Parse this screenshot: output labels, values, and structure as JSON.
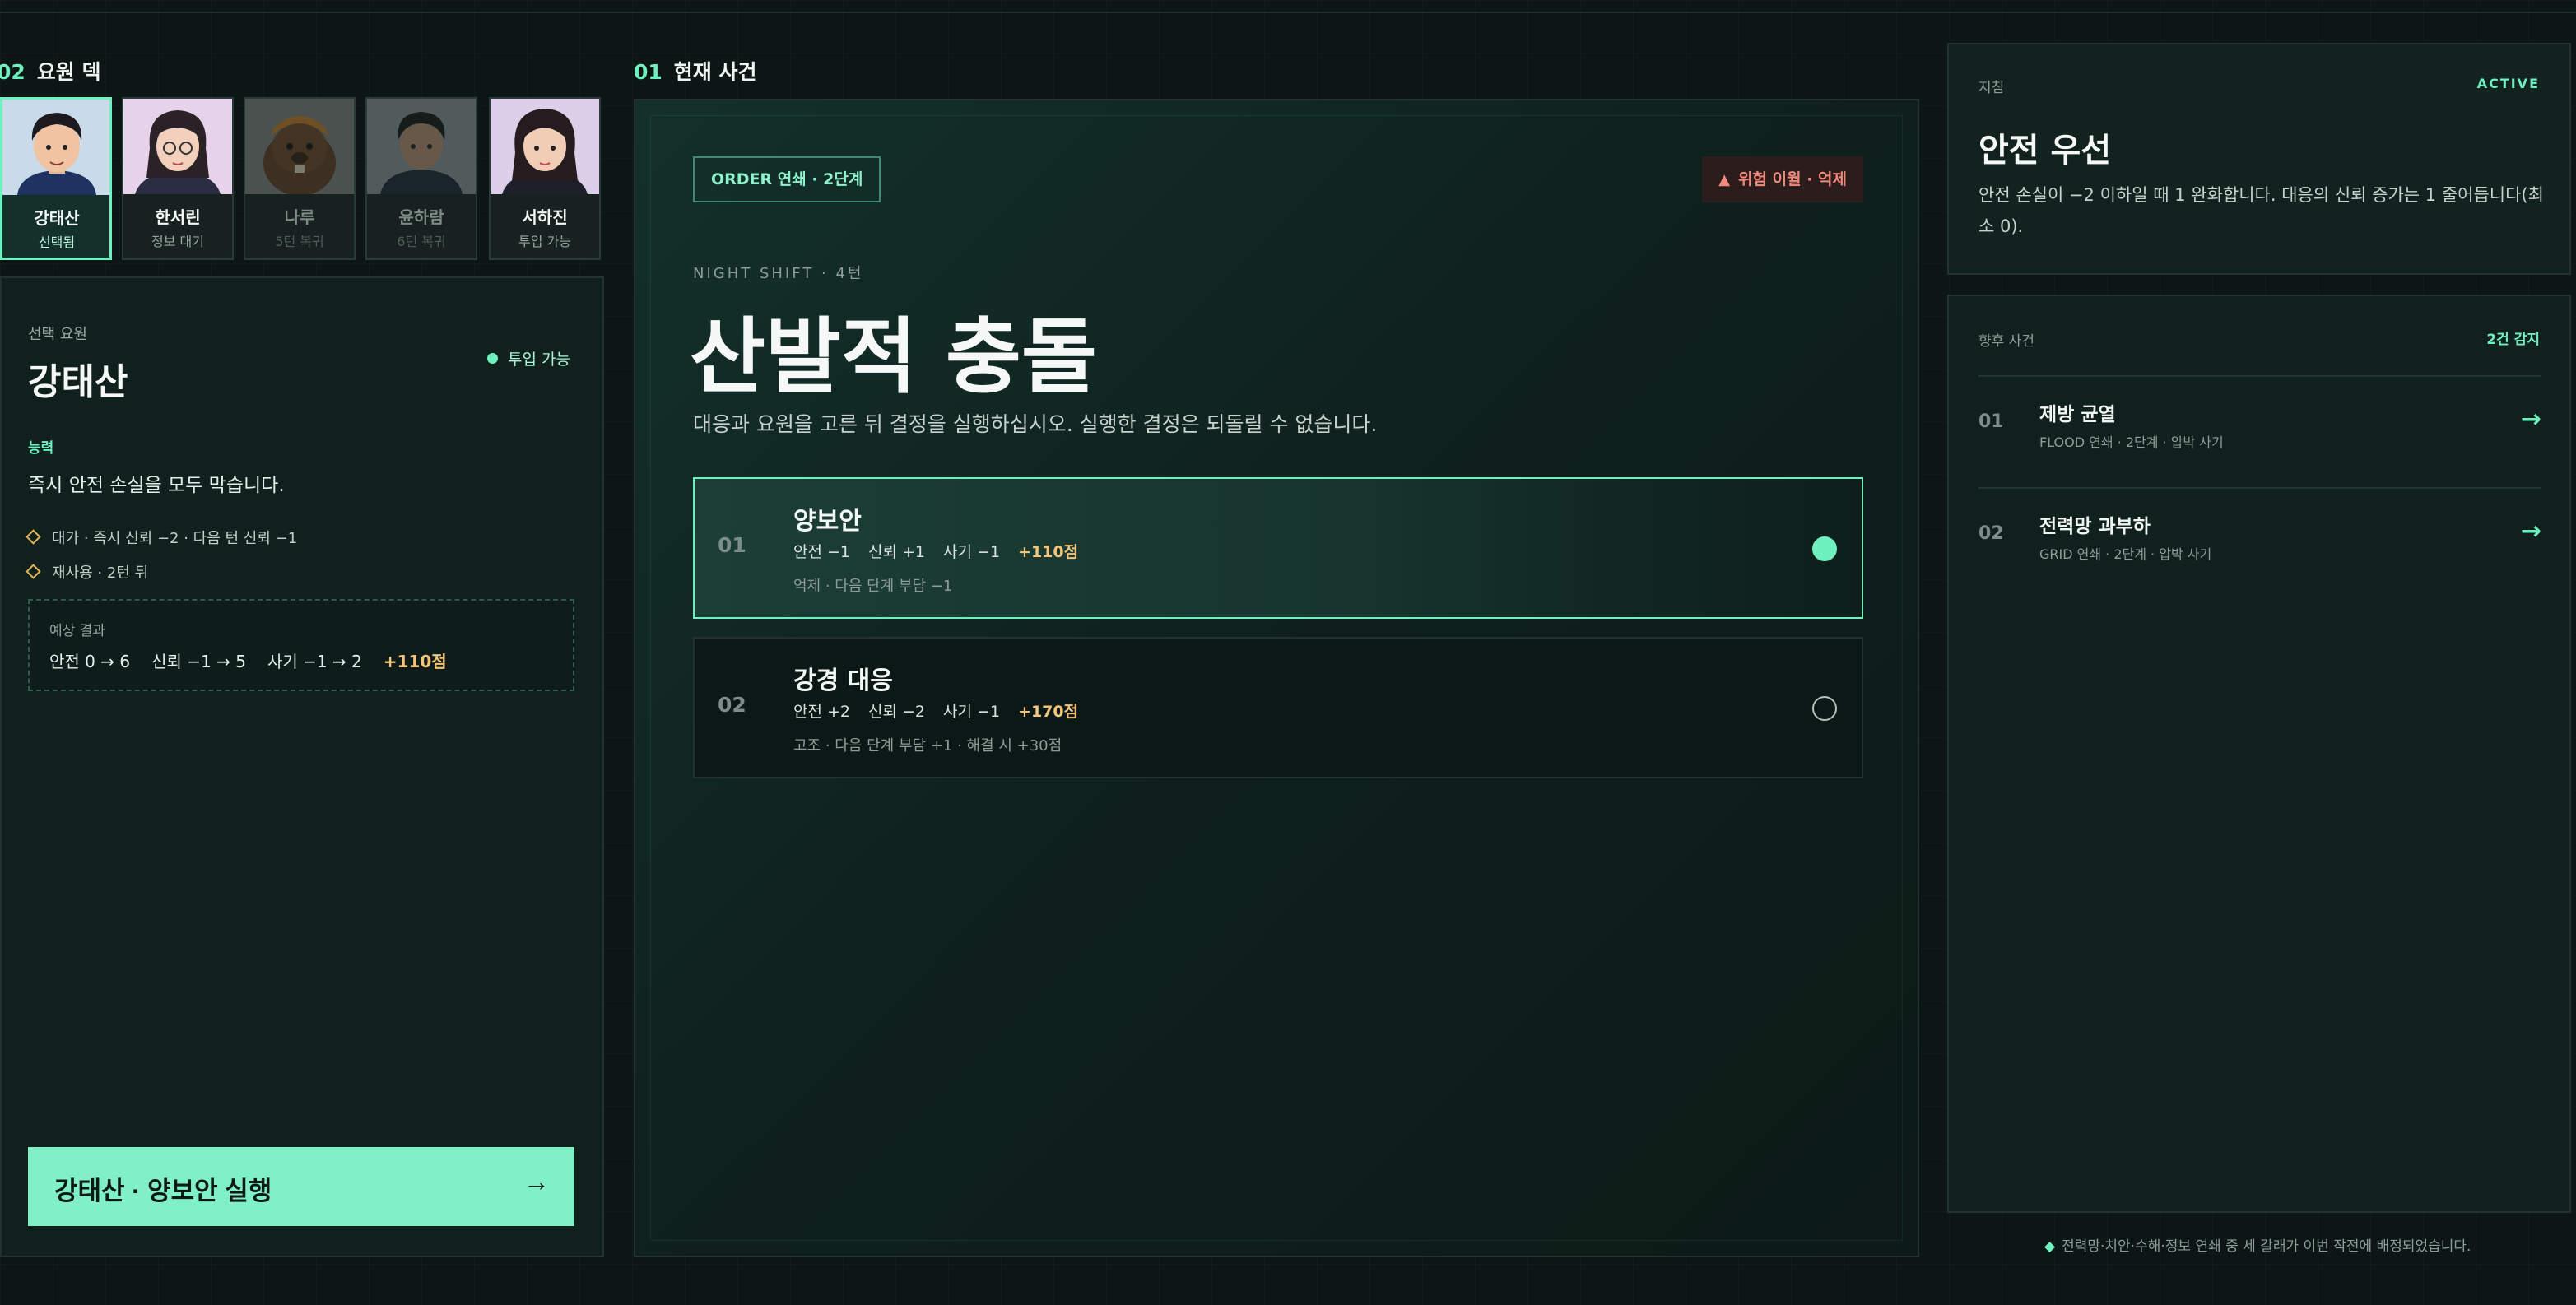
{
  "roster": {
    "section_num": "02",
    "section_title": "요원 덱",
    "agents": [
      {
        "name": "강태산",
        "status": "선택됨"
      },
      {
        "name": "한서린",
        "status": "정보 대기"
      },
      {
        "name": "나루",
        "status": "5턴 복귀"
      },
      {
        "name": "윤하람",
        "status": "6턴 복귀"
      },
      {
        "name": "서하진",
        "status": "투입 가능"
      }
    ]
  },
  "agent_panel": {
    "label": "선택 요원",
    "name": "강태산",
    "status": "투입 가능",
    "ability_label": "능력",
    "ability": "즉시 안전 손실을 모두 막습니다.",
    "cost": "대가 · 즉시 신뢰 −2 · 다음 턴 신뢰 −1",
    "reuse": "재사용 · 2턴 뒤",
    "expect_label": "예상 결과",
    "expect": {
      "safety": "안전 0 → 6",
      "trust": "신뢰 −1 → 5",
      "morale": "사기 −1 → 2",
      "points": "+110점"
    },
    "execute_label": "강태산 · 양보안 실행",
    "execute_arrow": "→"
  },
  "incident": {
    "section_num": "01",
    "section_title": "현재 사건",
    "order_tag": "ORDER 연쇄 · 2단계",
    "risk_tag": "위험 이월 · 억제",
    "night": "NIGHT SHIFT · 4턴",
    "title": "산발적 충돌",
    "description": "대응과 요원을 고른 뒤 결정을 실행하십시오. 실행한 결정은 되돌릴 수 없습니다.",
    "options": [
      {
        "num": "01",
        "name": "양보안",
        "stats": [
          "안전 −1",
          "신뢰 +1",
          "사기 −1"
        ],
        "points": "+110점",
        "note": "억제 · 다음 단계 부담 −1"
      },
      {
        "num": "02",
        "name": "강경 대응",
        "stats": [
          "안전 +2",
          "신뢰 −2",
          "사기 −1"
        ],
        "points": "+170점",
        "note": "고조 · 다음 단계 부담 +1 · 해결 시 +30점"
      }
    ]
  },
  "directive": {
    "label": "지침",
    "active": "ACTIVE",
    "title": "안전 우선",
    "text": "안전 손실이 −2 이하일 때 1 완화합니다. 대응의 신뢰 증가는 1 줄어듭니다(최소 0)."
  },
  "future": {
    "label": "향후 사건",
    "count": "2건 감지",
    "items": [
      {
        "num": "01",
        "name": "제방 균열",
        "sub": "FLOOD 연쇄 · 2단계 · 압박 사기",
        "arrow": "→"
      },
      {
        "num": "02",
        "name": "전력망 과부하",
        "sub": "GRID 연쇄 · 2단계 · 압박 사기",
        "arrow": "→"
      }
    ]
  },
  "footnote": "전력망·치안·수해·정보 연쇄 중 세 갈래가 이번 작전에 배정되었습니다.",
  "colors": {
    "accent": "#6ff0bf",
    "button": "#80f0c6",
    "points": "#f3c57a",
    "risk": "#f08a7c",
    "background": "#0c1715"
  }
}
